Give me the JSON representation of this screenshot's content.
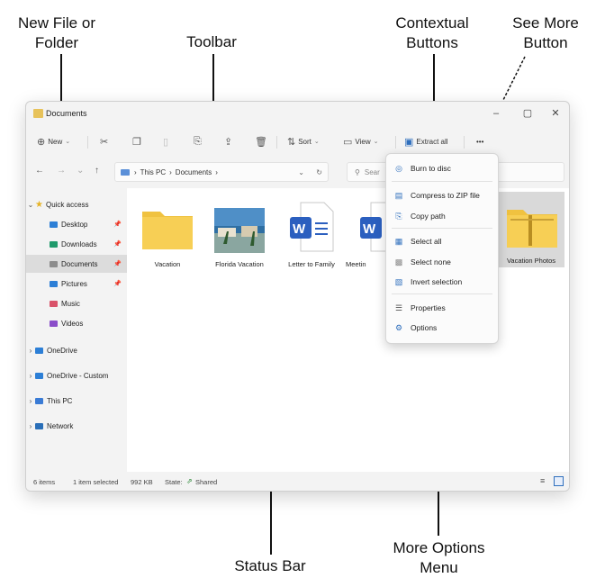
{
  "callouts": {
    "new_file_folder": [
      "New File or",
      "Folder"
    ],
    "toolbar": "Toolbar",
    "contextual_buttons": [
      "Contextual",
      "Buttons"
    ],
    "see_more": [
      "See More",
      "Button"
    ],
    "more_options": [
      "More Options",
      "Menu"
    ],
    "status_bar": "Status Bar"
  },
  "window": {
    "title": "Documents",
    "controls": {
      "minimize": "–",
      "maximize": "▢",
      "close": "✕"
    }
  },
  "toolbar": {
    "new_label": "New",
    "sort_label": "Sort",
    "view_label": "View",
    "extract_label": "Extract all",
    "more_label": "•••"
  },
  "address": {
    "path": [
      "This PC",
      "Documents"
    ],
    "search_placeholder": "Sear"
  },
  "sidebar": {
    "quick_access": "Quick access",
    "items": [
      {
        "label": "Desktop",
        "color": "#2d7fd6",
        "pinned": true
      },
      {
        "label": "Downloads",
        "color": "#1f9a6b",
        "pinned": true
      },
      {
        "label": "Documents",
        "color": "#8c8c8c",
        "pinned": true
      },
      {
        "label": "Pictures",
        "color": "#2d7fd6",
        "pinned": true
      },
      {
        "label": "Music",
        "color": "#d9536a",
        "pinned": false
      },
      {
        "label": "Videos",
        "color": "#8a4dc9",
        "pinned": false
      }
    ],
    "onedrive": "OneDrive",
    "onedrive_custom": "OneDrive - Custom",
    "this_pc": "This PC",
    "network": "Network"
  },
  "files": [
    {
      "name": "Vacation",
      "type": "folder"
    },
    {
      "name": "Florida Vacation",
      "type": "image"
    },
    {
      "name": "Letter to Family",
      "type": "word"
    },
    {
      "name": "Meetin",
      "type": "word"
    },
    {
      "name": "Vacation Photos",
      "type": "zip"
    }
  ],
  "status": {
    "count": "6 items",
    "selected": "1 item selected",
    "size": "992 KB",
    "state_label": "State:",
    "state_value": "Shared"
  },
  "menu": {
    "items": [
      "Burn to disc",
      "Compress to ZIP file",
      "Copy path",
      "Select all",
      "Select none",
      "Invert selection",
      "Properties",
      "Options"
    ]
  }
}
